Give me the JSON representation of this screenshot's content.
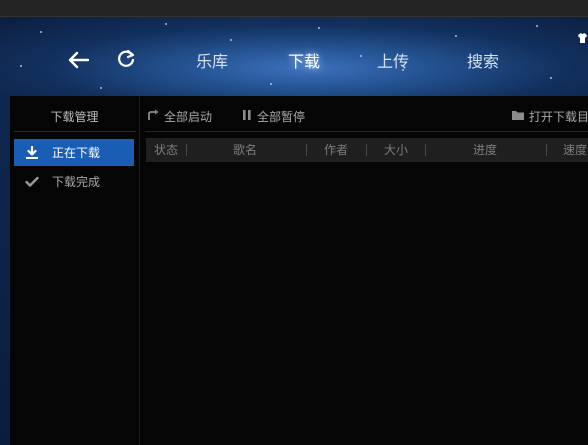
{
  "nav": {
    "tabs": [
      {
        "label": "乐库",
        "active": false
      },
      {
        "label": "下载",
        "active": true
      },
      {
        "label": "上传",
        "active": false
      },
      {
        "label": "搜索",
        "active": false
      }
    ],
    "back_icon": "back-arrow-icon",
    "refresh_icon": "refresh-icon"
  },
  "sidebar": {
    "title": "下载管理",
    "items": [
      {
        "label": "正在下载",
        "icon": "download-icon",
        "active": true
      },
      {
        "label": "下载完成",
        "icon": "checkmark-icon",
        "active": false
      }
    ]
  },
  "toolbar": {
    "start_all": "全部启动",
    "pause_all": "全部暂停",
    "open_folder": "打开下载目录"
  },
  "table": {
    "columns": [
      "状态",
      "歌名",
      "作者",
      "大小",
      "进度",
      "速度"
    ],
    "rows": []
  },
  "colors": {
    "accent": "#1a5db4",
    "panel_bg": "#050505",
    "header_bg": "#1f1f1f"
  }
}
